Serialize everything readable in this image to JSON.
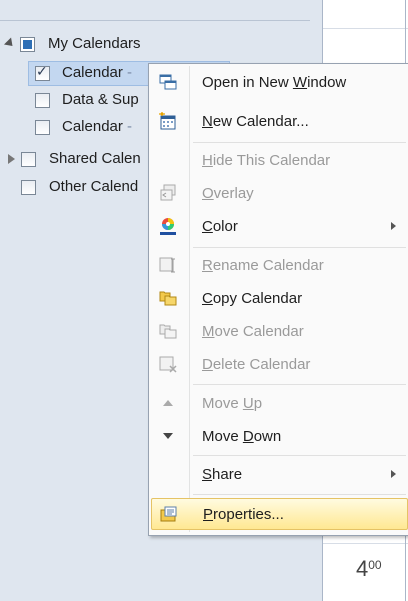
{
  "nav": {
    "groups": [
      {
        "label": "My Calendars"
      },
      {
        "label": "Shared Calen"
      },
      {
        "label": "Other Calend"
      }
    ],
    "calendars": [
      {
        "label": "Calendar",
        "suffix": " -",
        "checked": true
      },
      {
        "label": "Data & Sup",
        "checked": false
      },
      {
        "label": "Calendar",
        "suffix": " -",
        "checked": false
      }
    ]
  },
  "calendar_view": {
    "time_hour": "4",
    "time_minutes": "00"
  },
  "context_menu": {
    "items": [
      {
        "pre": "Open in New ",
        "acc": "W",
        "post": "indow",
        "enabled": true,
        "icon": "open-window-icon"
      },
      {
        "pre": "",
        "acc": "N",
        "post": "ew Calendar...",
        "enabled": true,
        "icon": "new-calendar-icon"
      },
      {
        "pre": "",
        "acc": "H",
        "post": "ide This Calendar",
        "enabled": false,
        "icon": ""
      },
      {
        "pre": "",
        "acc": "O",
        "post": "verlay",
        "enabled": false,
        "icon": "overlay-icon"
      },
      {
        "pre": "",
        "acc": "C",
        "post": "olor",
        "enabled": true,
        "icon": "color-icon",
        "submenu": true
      },
      {
        "pre": "",
        "acc": "R",
        "post": "ename Calendar",
        "enabled": false,
        "icon": "rename-icon"
      },
      {
        "pre": "",
        "acc": "C",
        "post": "opy Calendar",
        "enabled": true,
        "icon": "copy-calendar-icon"
      },
      {
        "pre": "",
        "acc": "M",
        "post": "ove Calendar",
        "enabled": false,
        "icon": "move-calendar-icon"
      },
      {
        "pre": "",
        "acc": "D",
        "post": "elete Calendar",
        "enabled": false,
        "icon": "delete-calendar-icon"
      },
      {
        "pre": "Move ",
        "acc": "U",
        "post": "p",
        "enabled": false,
        "icon": "move-up-icon"
      },
      {
        "pre": "Move ",
        "acc": "D",
        "post": "own",
        "enabled": true,
        "icon": "move-down-icon"
      },
      {
        "pre": "",
        "acc": "S",
        "post": "hare",
        "enabled": true,
        "icon": "",
        "submenu": true
      },
      {
        "pre": "",
        "acc": "P",
        "post": "roperties...",
        "enabled": true,
        "icon": "properties-icon",
        "highlighted": true
      }
    ]
  }
}
